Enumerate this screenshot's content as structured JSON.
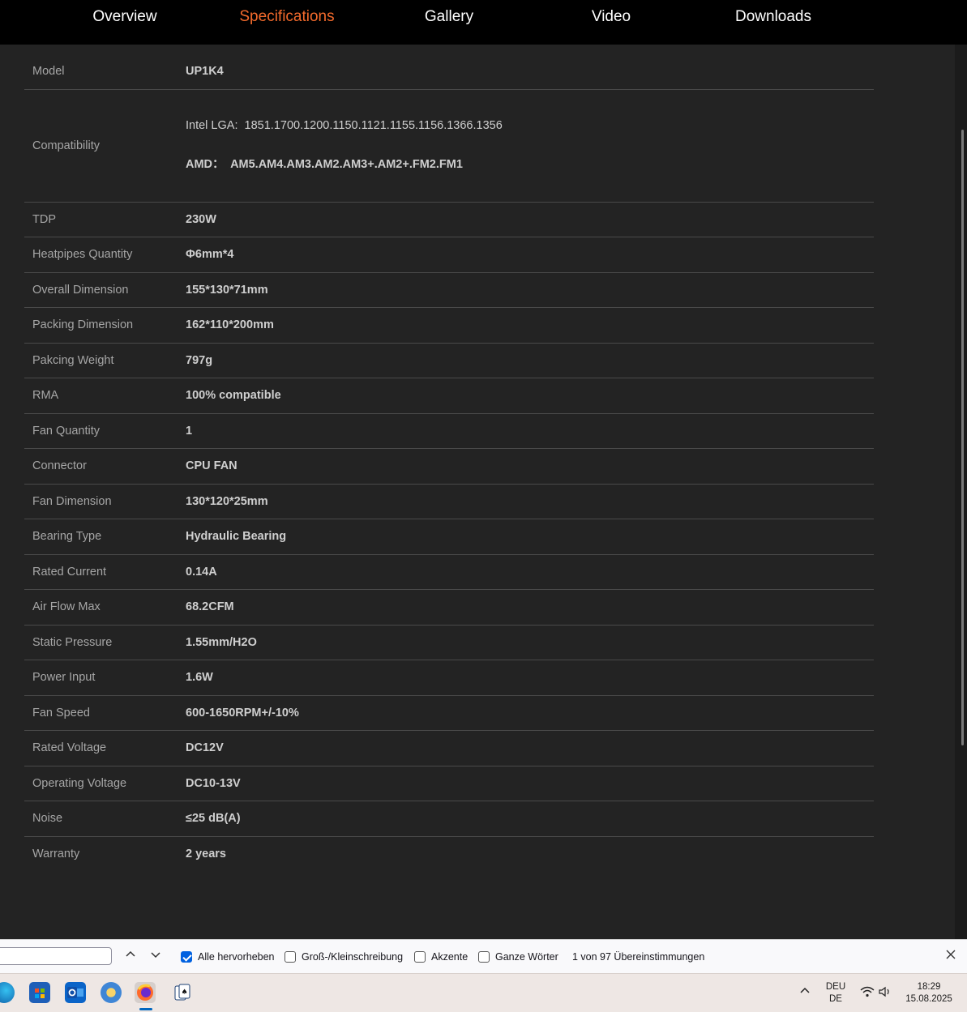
{
  "nav": {
    "tabs": [
      {
        "label": "Overview",
        "active": false
      },
      {
        "label": "Specifications",
        "active": true
      },
      {
        "label": "Gallery",
        "active": false
      },
      {
        "label": "Video",
        "active": false
      },
      {
        "label": "Downloads",
        "active": false
      }
    ],
    "active_color": "#f26a2c"
  },
  "specs": {
    "model": {
      "label": "Model",
      "value": "UP1K4"
    },
    "compatibility": {
      "label": "Compatibility",
      "intel_prefix": "Intel LGA:",
      "intel_value": "1851.1700.1200.1150.1121.1155.1156.1366.1356",
      "amd_prefix": "AMD：",
      "amd_value": "AM5.AM4.AM3.AM2.AM3+.AM2+.FM2.FM1"
    },
    "rows": [
      {
        "label": "TDP",
        "value": "230W"
      },
      {
        "label": "Heatpipes Quantity",
        "value": "Φ6mm*4"
      },
      {
        "label": "Overall Dimension",
        "value": "155*130*71mm"
      },
      {
        "label": "Packing Dimension",
        "value": "162*110*200mm"
      },
      {
        "label": "Pakcing Weight",
        "value": "797g"
      },
      {
        "label": "RMA",
        "value": "100% compatible"
      },
      {
        "label": "Fan Quantity",
        "value": "1"
      },
      {
        "label": "Connector",
        "value": "CPU FAN"
      },
      {
        "label": "Fan Dimension",
        "value": "130*120*25mm"
      },
      {
        "label": "Bearing Type",
        "value": "Hydraulic Bearing"
      },
      {
        "label": "Rated Current",
        "value": "0.14A"
      },
      {
        "label": "Air Flow Max",
        "value": "68.2CFM"
      },
      {
        "label": "Static Pressure",
        "value": "1.55mm/H2O"
      },
      {
        "label": "Power Input",
        "value": "1.6W"
      },
      {
        "label": "Fan Speed",
        "value": "600-1650RPM+/-10%"
      },
      {
        "label": "Rated Voltage",
        "value": "DC12V"
      },
      {
        "label": "Operating Voltage",
        "value": "DC10-13V"
      },
      {
        "label": "Noise",
        "value": "≤25 dB(A)"
      },
      {
        "label": "Warranty",
        "value": "2 years"
      }
    ]
  },
  "findbar": {
    "search_value": "",
    "highlight_all": "Alle hervorheben",
    "match_case": "Groß-/Kleinschreibung",
    "diacritics": "Akzente",
    "whole_words": "Ganze Wörter",
    "status": "1 von 97 Übereinstimmungen"
  },
  "taskbar": {
    "lang_top": "DEU",
    "lang_bottom": "DE",
    "time": "18:29",
    "date": "15.08.2025",
    "icons": [
      "edge-icon",
      "store-icon",
      "outlook-icon",
      "settings-app-icon",
      "firefox-icon",
      "solitaire-icon"
    ]
  }
}
